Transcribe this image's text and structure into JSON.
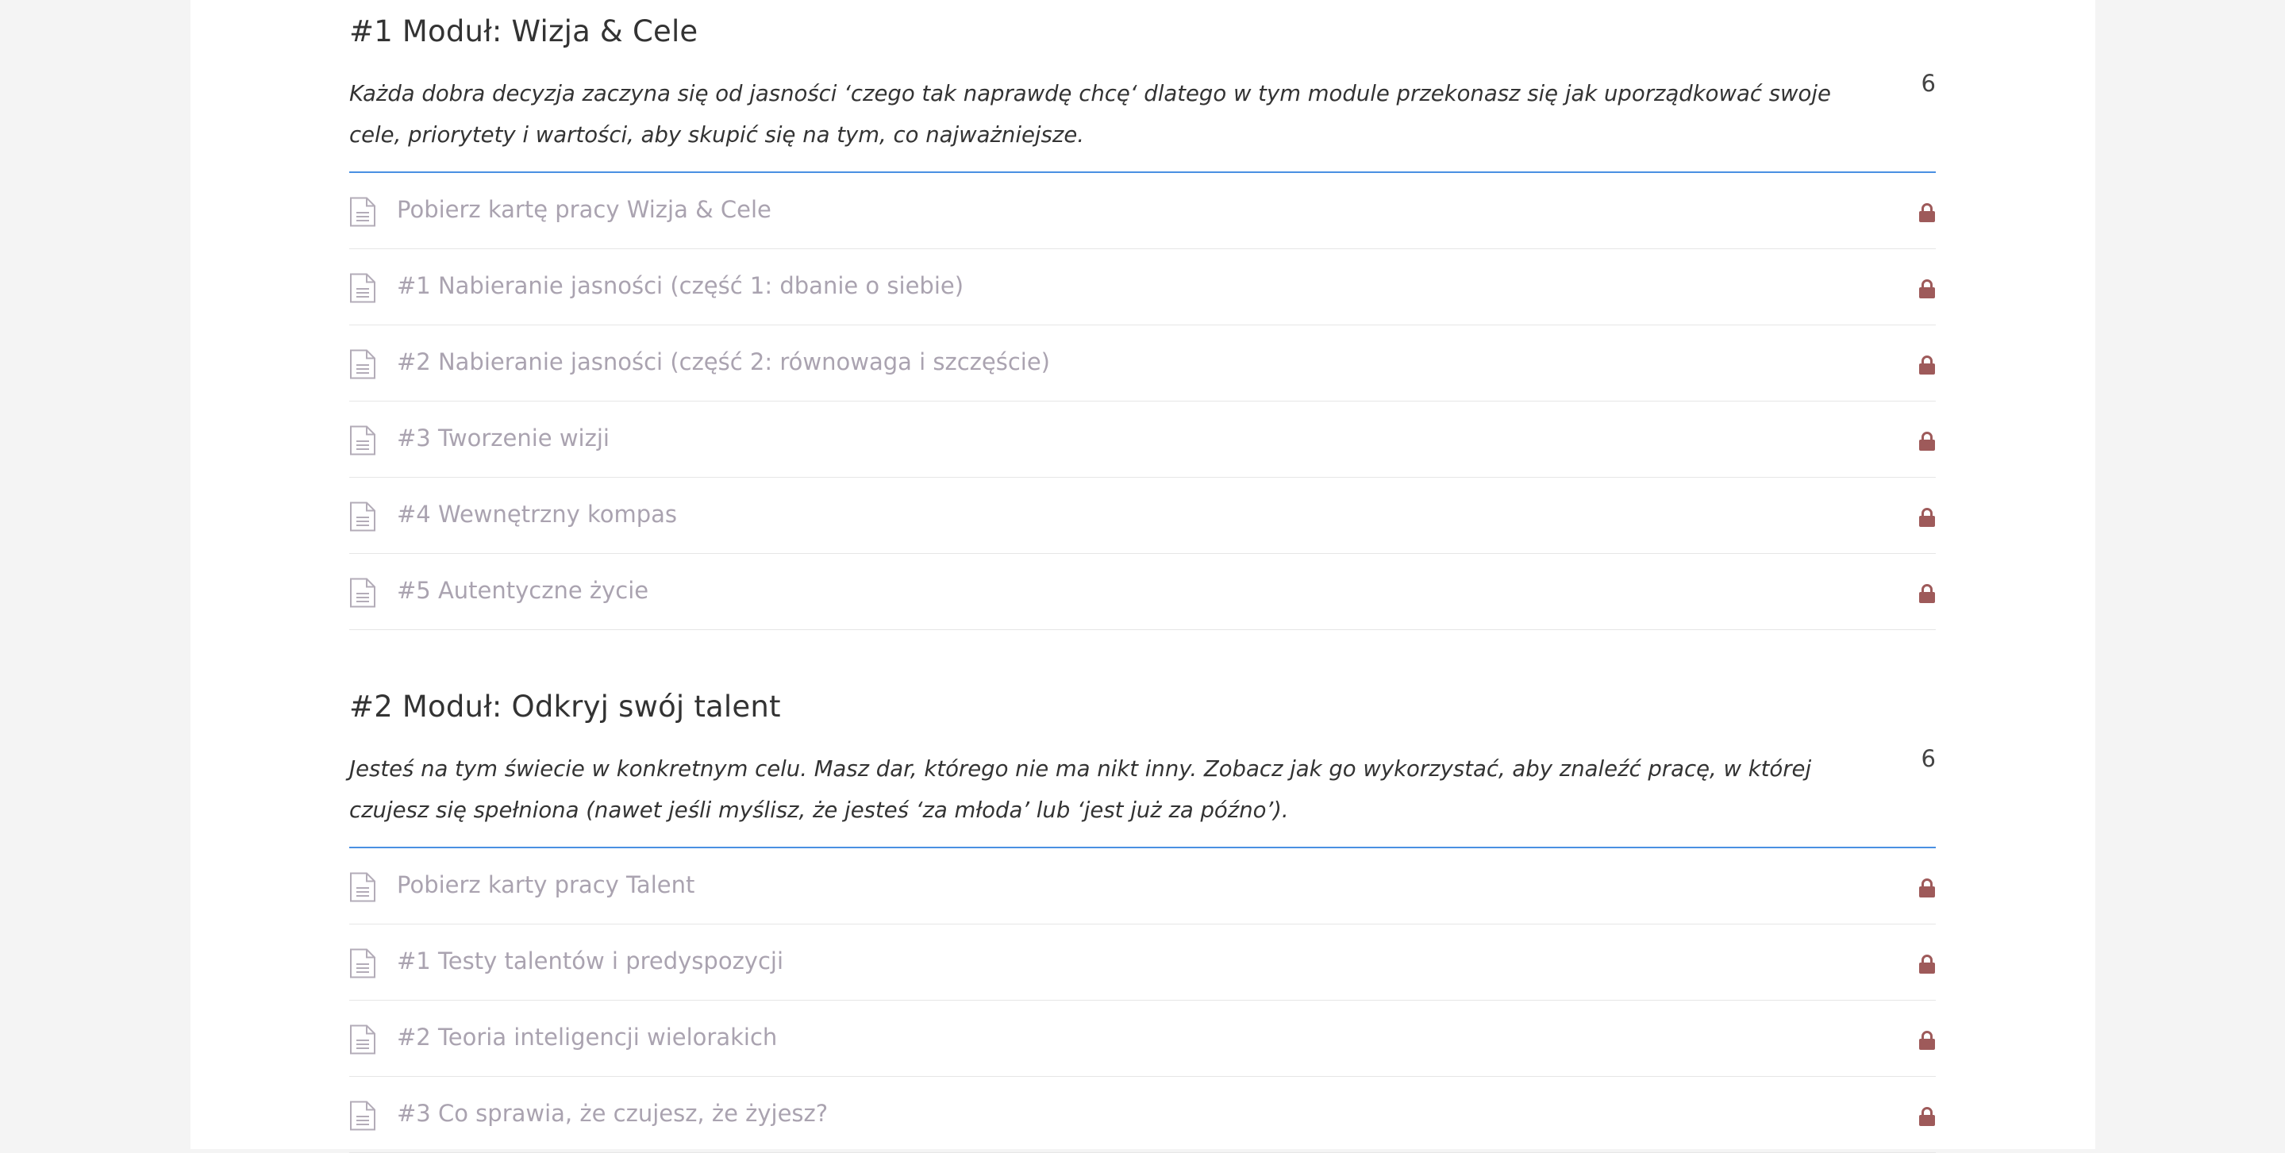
{
  "modules": [
    {
      "title": "#1 Moduł: Wizja & Cele",
      "description": "Każda dobra decyzja zaczyna się od jasności ‘czego tak naprawdę chcę‘ dlatego w tym module przekonasz się jak uporządkować swoje cele, priorytety i wartości, aby skupić się na tym, co najważniejsze.",
      "count": "6",
      "lessons": [
        {
          "label": "Pobierz kartę pracy Wizja & Cele",
          "icon": "document-icon",
          "status_icon": "lock-icon"
        },
        {
          "label": "#1 Nabieranie jasności (część 1: dbanie o siebie)",
          "icon": "document-icon",
          "status_icon": "lock-icon"
        },
        {
          "label": "#2 Nabieranie jasności (część 2: równowaga i szczęście)",
          "icon": "document-icon",
          "status_icon": "lock-icon"
        },
        {
          "label": "#3 Tworzenie wizji",
          "icon": "document-icon",
          "status_icon": "lock-icon"
        },
        {
          "label": "#4 Wewnętrzny kompas",
          "icon": "document-icon",
          "status_icon": "lock-icon"
        },
        {
          "label": "#5 Autentyczne życie",
          "icon": "document-icon",
          "status_icon": "lock-icon"
        }
      ]
    },
    {
      "title": "#2 Moduł: Odkryj swój talent",
      "description": "Jesteś na tym świecie w konkretnym celu. Masz dar, którego nie ma nikt inny. Zobacz jak go wykorzystać, aby znaleźć pracę, w której czujesz się spełniona (nawet jeśli myślisz, że jesteś ‘za młoda’ lub ‘jest już za późno’).",
      "count": "6",
      "lessons": [
        {
          "label": "Pobierz karty pracy Talent",
          "icon": "document-icon",
          "status_icon": "lock-icon"
        },
        {
          "label": "#1 Testy talentów i predyspozycji",
          "icon": "document-icon",
          "status_icon": "lock-icon"
        },
        {
          "label": "#2 Teoria inteligencji wielorakich",
          "icon": "document-icon",
          "status_icon": "lock-icon"
        },
        {
          "label": "#3 Co sprawia, że czujesz, że żyjesz?",
          "icon": "document-icon",
          "status_icon": "lock-icon"
        }
      ]
    }
  ],
  "colors": {
    "accent_line": "#4a90e2",
    "lesson_text": "#aaa3b0",
    "lock": "#9e5a5a",
    "page_bg": "#f4f4f4",
    "card_bg": "#ffffff"
  }
}
